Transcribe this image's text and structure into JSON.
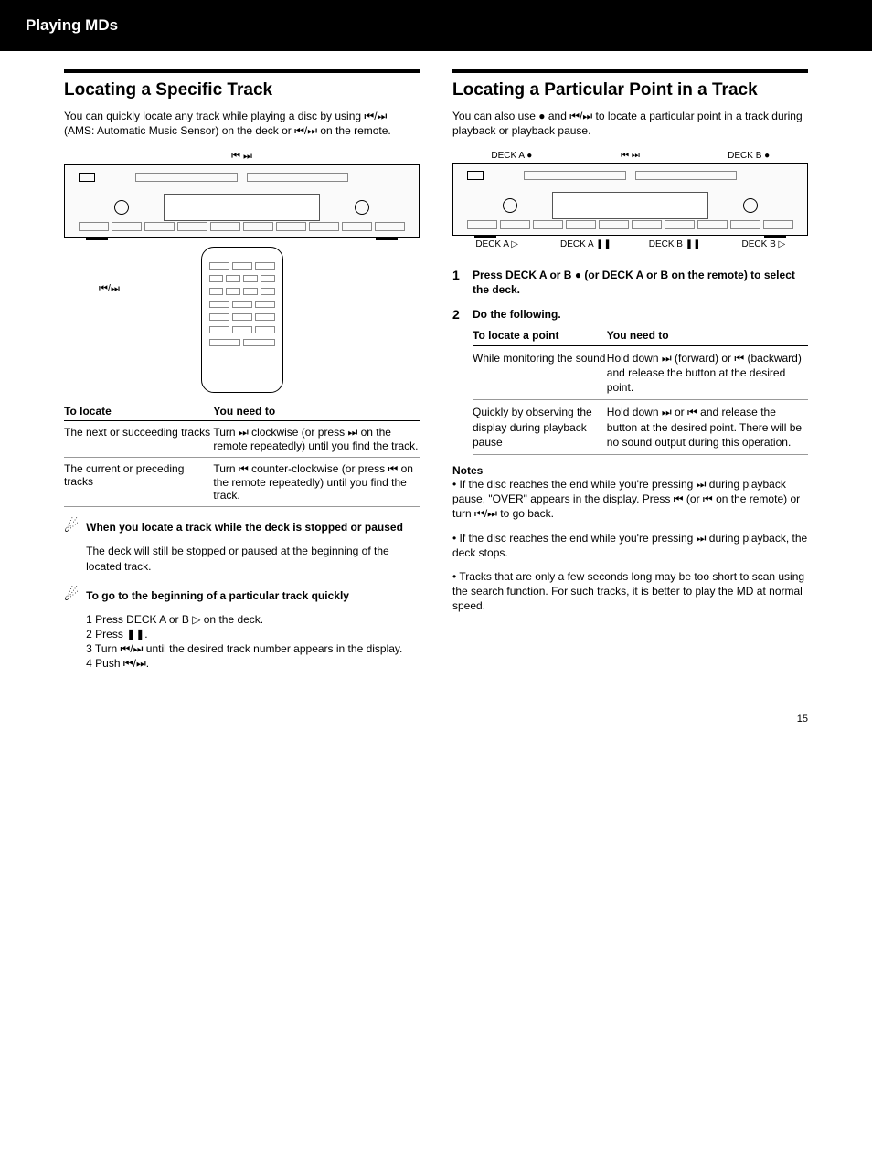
{
  "header": {
    "section": "Playing MDs"
  },
  "page": {
    "number": "15"
  },
  "left": {
    "title": "Locating a Specific Track",
    "intro_1": "You can quickly locate any track while playing a disc by using ",
    "intro_2": " (AMS: Automatic Music Sensor) on the deck or ",
    "intro_3": " on the remote.",
    "sym_ams": "⏮/⏭",
    "sym_prevnext": "⏮/⏭",
    "diagram_top": "⏮    ⏭",
    "remote_label": "⏮/⏭",
    "tbl_hdr_left": "To locate",
    "tbl_hdr_right": "You need to",
    "r1_left": "The next or succeeding tracks",
    "r1_right_1": "Turn ",
    "r1_right_2": " clockwise (or press ",
    "r1_right_3": " on the remote repeatedly) until you find the track.",
    "r1_sym_a": "⏭",
    "r1_sym_b": "⏭",
    "r2_left": "The current or preceding tracks",
    "r2_right_1": "Turn ",
    "r2_right_2": " counter-clockwise (or press ",
    "r2_right_3": " on the remote repeatedly) until you find the track.",
    "r2_sym_a": "⏮",
    "r2_sym_b": "⏮",
    "tip1_hdr": "When you locate a track while the deck is stopped or paused",
    "tip1_body": "The deck will still be stopped or paused at the beginning of the located track.",
    "tip2_hdr": "To go to the beginning of a particular track quickly",
    "tip2_body_1": "1 Press DECK A or B ",
    "tip2_body_2": " on the deck.",
    "tip2_body_3": "2 Press ",
    "tip2_body_4": ".",
    "tip2_body_5": "3 Turn ",
    "tip2_body_6": " until the desired track number appears in the display.",
    "tip2_body_7": "4 Push ",
    "tip2_body_8": ".",
    "play_sym": "▷",
    "pause_sym": "❚❚",
    "ams_sym_single": "⏮/⏭",
    "ams_push": "⏮/⏭"
  },
  "right": {
    "title": "Locating a Particular Point in a Track",
    "intro_1": "You can also use ",
    "intro_2": " and ",
    "intro_3": " to locate a particular point in a track during playback or playback pause.",
    "sym_rec": "●",
    "sym_prevnext": "⏮/⏭",
    "diagram_top_left": "DECK A ●",
    "diagram_top_mid": "⏮    ⏭",
    "diagram_top_right": "DECK B ●",
    "diagram_bottom_1": "DECK A ▷",
    "diagram_bottom_2": "DECK A ❚❚",
    "diagram_bottom_3": "DECK B ❚❚",
    "diagram_bottom_4": "DECK B ▷",
    "instr1_hdr": "Press DECK A or B ",
    "instr1_sym": "●",
    "instr1_tail": " (or DECK A or B on the remote) to select the deck.",
    "instr2_hdr": "Do the following.",
    "tbl2_hdr_left": "To locate a point",
    "tbl2_hdr_right": "You need to",
    "r2a_left": "While monitoring the sound",
    "r2a_right_1": "Hold down ",
    "r2a_right_2": " (forward) or ",
    "r2a_right_3": " (backward) and release the button at the desired point.",
    "r2a_sym_a": "⏭",
    "r2a_sym_b": "⏮",
    "r2b_left": "Quickly by observing the display during playback pause",
    "r2b_right_1": "Hold down ",
    "r2b_right_2": " or ",
    "r2b_right_3": " and release the button at the desired point. There will be no sound output during this operation.",
    "r2b_sym_a": "⏭",
    "r2b_sym_b": "⏮",
    "note_hdr": "Notes",
    "note_body_1": "• If the disc reaches the end while you're pressing ",
    "note_sym_a": "⏭",
    "note_body_2": " during playback pause, \"OVER\" appears in the display. Press ",
    "note_sym_b": "⏮",
    "note_body_3": " (or ",
    "note_sym_c": "⏮",
    "note_body_4": " on the remote) or turn ",
    "note_sym_d": "⏮/⏭",
    "note_body_5": " to go back.",
    "note2_body_1": "• If the disc reaches the end while you're pressing ",
    "note2_sym_a": "⏭",
    "note2_body_2": " during playback, the deck stops.",
    "note3_body": "• Tracks that are only a few seconds long may be too short to scan using the search function. For such tracks, it is better to play the MD at normal speed."
  }
}
